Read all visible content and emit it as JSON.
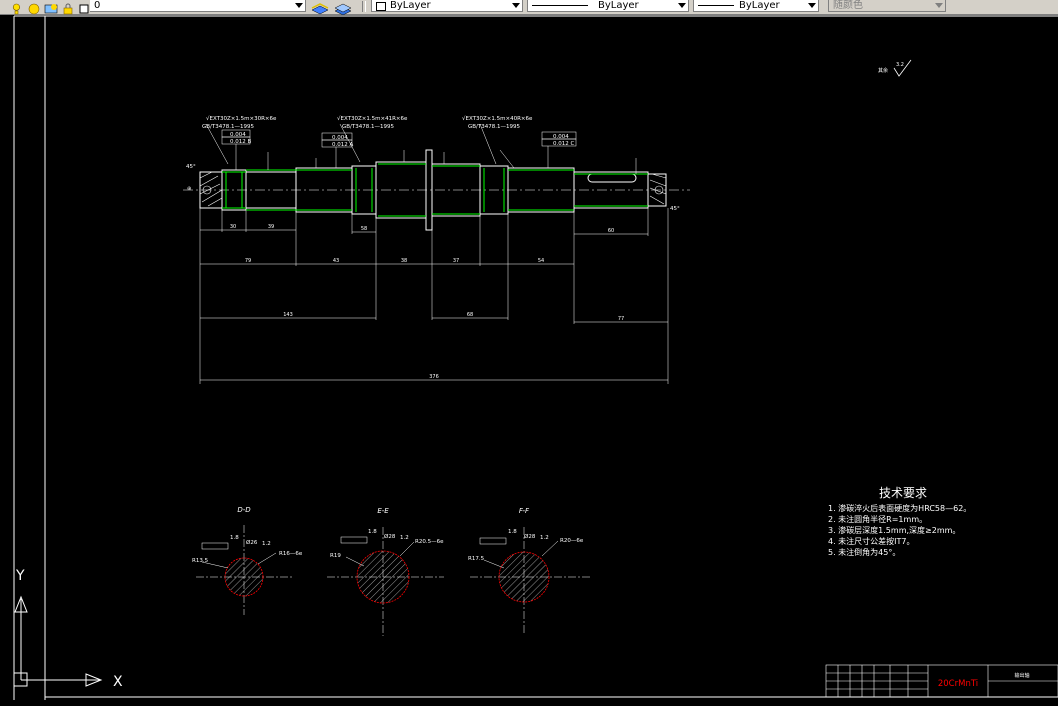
{
  "toolbar": {
    "layer_value": "0",
    "color_value": "ByLayer",
    "linetype_value": "ByLayer",
    "lineweight_value": "ByLayer",
    "plotstyle_value": "随颜色"
  },
  "drawing": {
    "shaft_top_notes": [
      {
        "line1": "√EXT30Z×1.5m×30R×6e",
        "line2": "GB/T3478.1—1995"
      },
      {
        "line1": "√EXT30Z×1.5m×41R×6e",
        "line2": "GB/T3478.1—1995"
      },
      {
        "line1": "√EXT30Z×1.5m×40R×6e",
        "line2": "GB/T3478.1—1995"
      }
    ],
    "tolerance_frames": [
      {
        "a": "0.004",
        "b": "0.012 B"
      },
      {
        "a": "0.004",
        "b": "0.012 A"
      },
      {
        "a": "0.004",
        "b": "0.012 C"
      }
    ],
    "chamfer_left": "45°",
    "chamfer_right": "45°",
    "surface_mark": "其余",
    "roughness_mark": "3.2",
    "dim_row1": [
      "30",
      "39",
      "58"
    ],
    "dim_row1_right": "60",
    "dim_row2": [
      "79",
      "43",
      "38",
      "37",
      "54"
    ],
    "dim_row3": [
      "143",
      "68",
      "77"
    ],
    "dim_total": "376",
    "section_labels": {
      "a": "D-D",
      "b": "E-E",
      "c": "F-F"
    },
    "section_d": {
      "r1": "R13.5",
      "r2": "R16—6e",
      "d": "1.8",
      "dd": "Ø26",
      "w": "1.2"
    },
    "section_e": {
      "r1": "R19",
      "r2": "R20.5—6e",
      "d": "1.8",
      "dd": "Ø28",
      "w": "1.2"
    },
    "section_f": {
      "r1": "R17.5",
      "r2": "R20—6e",
      "d": "1.8",
      "dd": "Ø28",
      "w": "1.2"
    }
  },
  "tech_req": {
    "title": "技术要求",
    "items": [
      "1. 渗碳淬火后表面硬度为HRC58—62。",
      "2. 未注圆角半径R=1mm。",
      "3. 渗碳层深度1.5mm,深度≥2mm。",
      "4. 未注尺寸公差按IT7。",
      "5. 未注倒角为45°。"
    ]
  },
  "title_block": {
    "material": "20CrMnTi",
    "name": "输出轴"
  },
  "ucs": {
    "y_label": "Y",
    "x_label": "X"
  },
  "colors": {
    "background": "#000000",
    "outline": "#ffffff",
    "green": "#00ff00",
    "red": "#ff0000"
  }
}
